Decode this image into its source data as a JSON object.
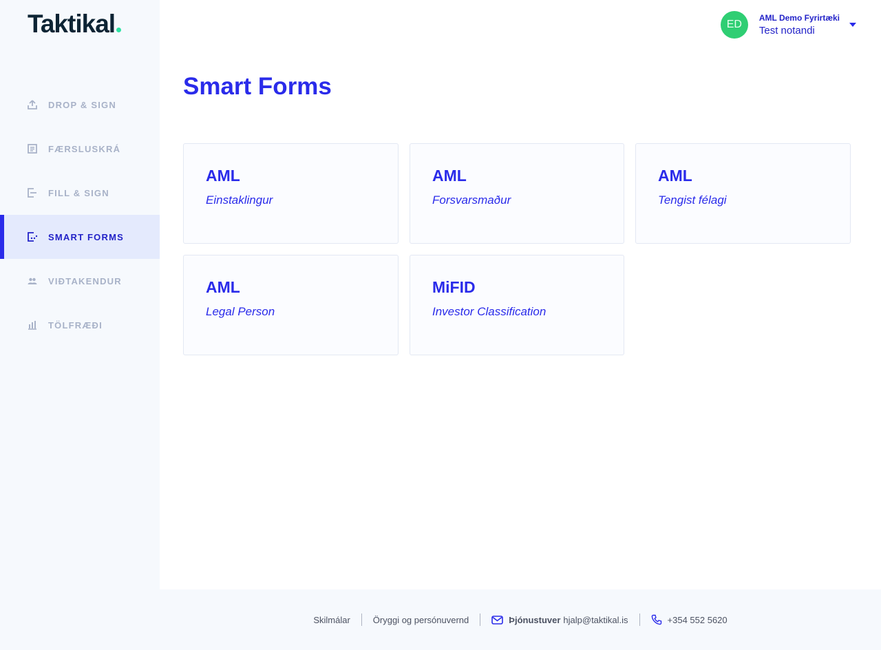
{
  "brand": {
    "logo_text": "Taktikal"
  },
  "sidebar": {
    "items": [
      {
        "label": "DROP & SIGN",
        "icon": "upload-icon"
      },
      {
        "label": "FÆRSLUSKRÁ",
        "icon": "list-icon"
      },
      {
        "label": "FILL & SIGN",
        "icon": "fill-sign-icon"
      },
      {
        "label": "SMART FORMS",
        "icon": "smart-forms-icon",
        "active": true
      },
      {
        "label": "VIÐTAKENDUR",
        "icon": "people-icon"
      },
      {
        "label": "TÖLFRÆÐI",
        "icon": "bar-chart-icon"
      }
    ]
  },
  "header": {
    "avatar_initials": "ED",
    "company": "AML Demo Fyrirtæki",
    "user": "Test notandi"
  },
  "main": {
    "title": "Smart Forms",
    "cards": [
      {
        "title": "AML",
        "subtitle": "Einstaklingur"
      },
      {
        "title": "AML",
        "subtitle": "Forsvarsmaður"
      },
      {
        "title": "AML",
        "subtitle": "Tengist félagi"
      },
      {
        "title": "AML",
        "subtitle": "Legal Person"
      },
      {
        "title": "MiFID",
        "subtitle": "Investor Classification"
      }
    ]
  },
  "footer": {
    "terms": "Skilmálar",
    "privacy": "Öryggi og persónuvernd",
    "support_label": "Þjónustuver",
    "support_email": "hjalp@taktikal.is",
    "phone": "+354 552 5620"
  },
  "colors": {
    "accent": "#2a2bea",
    "sidebar_bg": "#f6f9fd",
    "active_bg": "#e4eafd",
    "avatar": "#2fce73",
    "logo_dot": "#2ee2a4"
  }
}
